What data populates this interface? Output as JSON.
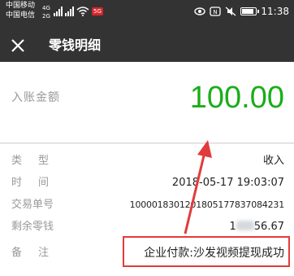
{
  "status_bar": {
    "carrier_1": "中国移动",
    "carrier_2": "中国电信",
    "sig_1": "4G",
    "sig_2": "2G",
    "app_badge": "5G",
    "time": "11:38",
    "icons": [
      "signal-icon",
      "wifi-icon",
      "eye-icon",
      "mute-icon",
      "nfc-icon",
      "battery-icon"
    ]
  },
  "nav": {
    "title": "零钱明细"
  },
  "amount": {
    "label": "入账金额",
    "value": "100.00",
    "color": "#1aad19"
  },
  "details": {
    "rows": [
      {
        "label": "类型",
        "value": "收入"
      },
      {
        "label": "时间",
        "value": "2018-05-17 19:03:07"
      },
      {
        "label": "交易单号",
        "value": "1000018301201805177837084231"
      },
      {
        "label": "剩余零钱",
        "value_prefix": "1",
        "value_suffix": "56.67"
      },
      {
        "label": "备注",
        "value": "企业付款:沙发视频提现成功"
      }
    ]
  },
  "annotation": {
    "box_color": "#e23b3b"
  }
}
